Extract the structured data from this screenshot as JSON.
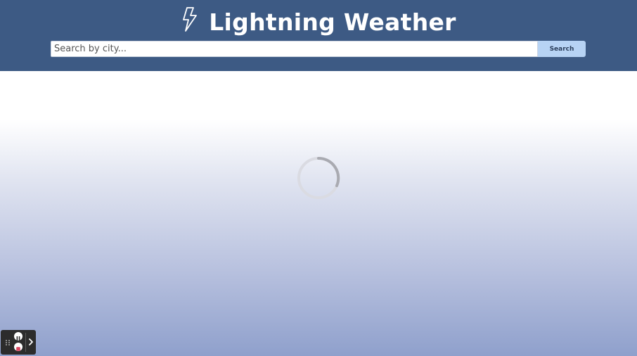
{
  "app": {
    "title": "Lightning Weather",
    "logo_icon": "lightning-bolt-icon"
  },
  "search": {
    "placeholder": "Search by city...",
    "value": "",
    "button_label": "Search"
  },
  "main": {
    "state": "loading",
    "spinner_icon": "loading-spinner-icon"
  },
  "recorder_controls": {
    "icons": [
      "drag-handle-icon",
      "pause-icon",
      "stop-icon",
      "chevron-right-icon"
    ]
  },
  "colors": {
    "header": "#3d5a84",
    "search_button": "#b7d3f4",
    "title_text": "#ffffff",
    "gradient_bottom": "#8fa0cc",
    "stop_accent": "#d9455f"
  }
}
